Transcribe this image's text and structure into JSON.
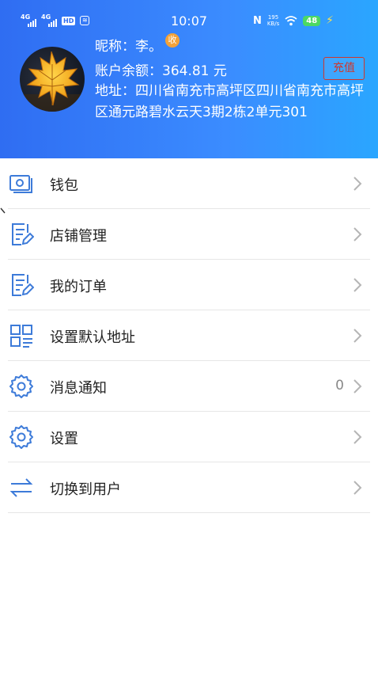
{
  "status_bar": {
    "network1": "4G",
    "network2": "4G",
    "hd": "HD",
    "app_badge": "≋",
    "time": "10:07",
    "n_mark": "N",
    "speed_value": "195",
    "speed_unit": "KB/s",
    "battery": "48"
  },
  "profile": {
    "nickname": "昵称：李。",
    "badge": "收",
    "balance": "账户余额：364.81 元",
    "recharge_label": "充值",
    "address": "地址：四川省南充市高坪区四川省南充市高坪区通元路碧水云天3期2栋2单元301"
  },
  "menu": {
    "items": [
      {
        "label": "钱包",
        "icon": "wallet-icon",
        "count": ""
      },
      {
        "label": "店铺管理",
        "icon": "store-edit-icon",
        "count": ""
      },
      {
        "label": "我的订单",
        "icon": "order-edit-icon",
        "count": ""
      },
      {
        "label": "设置默认地址",
        "icon": "grid-list-icon",
        "count": ""
      },
      {
        "label": "消息通知",
        "icon": "gear-icon",
        "count": "0"
      },
      {
        "label": "设置",
        "icon": "gear-icon",
        "count": ""
      },
      {
        "label": "切换到用户",
        "icon": "switch-arrows-icon",
        "count": ""
      }
    ]
  },
  "colors": {
    "header_start": "#2f6df2",
    "header_end": "#2aa6ff",
    "icon_blue": "#3d7bd9",
    "recharge_red": "#d0362c",
    "chevron_gray": "#b5b5b5"
  }
}
